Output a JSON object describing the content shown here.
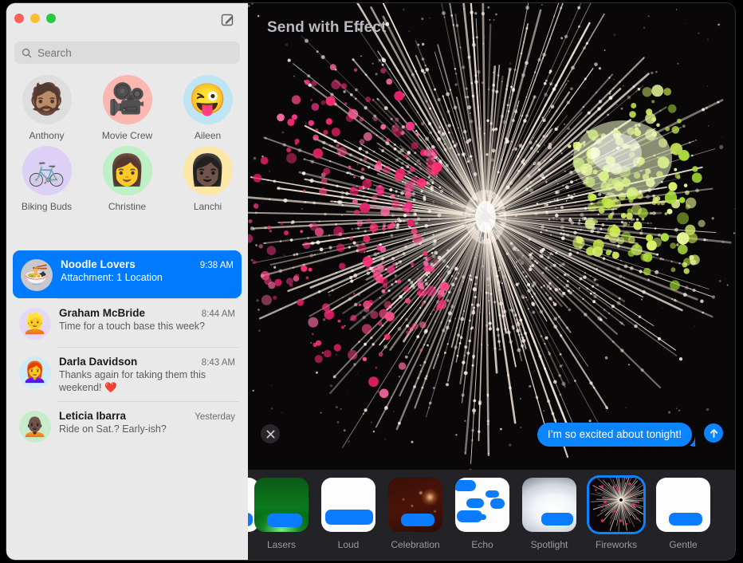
{
  "window": {
    "traffic_lights": [
      "close",
      "minimize",
      "maximize"
    ],
    "colors": {
      "close": "#ff5f57",
      "minimize": "#febc2e",
      "maximize": "#28c840",
      "accent_blue": "#007aff",
      "bubble_blue": "#0a84ff",
      "sidebar_bg": "#e9e9e9",
      "detail_bg": "#1c1c20",
      "stage_bg": "#0a0709",
      "tray_bg": "#232327"
    }
  },
  "sidebar": {
    "compose_icon": "compose-pencil-square-icon",
    "search": {
      "icon": "search-icon",
      "placeholder": "Search",
      "value": ""
    },
    "pinned": [
      {
        "name": "Anthony",
        "glyph": "🧔🏽",
        "bg": "#dedede"
      },
      {
        "name": "Movie Crew",
        "glyph": "🎥",
        "bg": "#fcb7b0"
      },
      {
        "name": "Aileen",
        "glyph": "😜",
        "bg": "#bfe5f5"
      },
      {
        "name": "Biking Buds",
        "glyph": "🚲",
        "bg": "#ddd0f7"
      },
      {
        "name": "Christine",
        "glyph": "👩",
        "bg": "#bdf0c5"
      },
      {
        "name": "Lanchi",
        "glyph": "👩🏿",
        "bg": "#fbe8a6"
      }
    ],
    "conversations": [
      {
        "name": "Noodle Lovers",
        "time": "9:38 AM",
        "preview": "Attachment: 1 Location",
        "glyph": "🍜",
        "bg": "#c9c9cd",
        "selected": true
      },
      {
        "name": "Graham McBride",
        "time": "8:44 AM",
        "preview": "Time for a touch base this week?",
        "glyph": "👱",
        "bg": "#e4d8f9",
        "selected": false
      },
      {
        "name": "Darla Davidson",
        "time": "8:43 AM",
        "preview": "Thanks again for taking them this weekend! ❤️",
        "glyph": "👩‍🦰",
        "bg": "#cfe9f7",
        "selected": false
      },
      {
        "name": "Leticia Ibarra",
        "time": "Yesterday",
        "preview": "Ride on Sat.? Early-ish?",
        "glyph": "🧑🏿‍🦲",
        "bg": "#c6eccb",
        "selected": false
      }
    ]
  },
  "detail": {
    "title": "Send with Effect",
    "close_icon": "close-x-icon",
    "send_icon": "send-arrow-up-icon",
    "message_bubble": "I’m so excited about tonight!",
    "preview_effect": "Fireworks",
    "effects": [
      {
        "label": "",
        "style": "bg-white",
        "selected": false,
        "partial": true
      },
      {
        "label": "Lasers",
        "style": "bg-lasers",
        "selected": false,
        "partial": false
      },
      {
        "label": "Loud",
        "style": "bg-white",
        "selected": false,
        "partial": false
      },
      {
        "label": "Celebration",
        "style": "bg-celebration",
        "selected": false,
        "partial": false
      },
      {
        "label": "Echo",
        "style": "bg-white",
        "selected": false,
        "partial": false
      },
      {
        "label": "Spotlight",
        "style": "bg-spotlight",
        "selected": false,
        "partial": false
      },
      {
        "label": "Fireworks",
        "style": "bg-fireworks-thumb",
        "selected": true,
        "partial": false
      },
      {
        "label": "Gentle",
        "style": "bg-gentle",
        "selected": false,
        "partial": false
      }
    ]
  }
}
